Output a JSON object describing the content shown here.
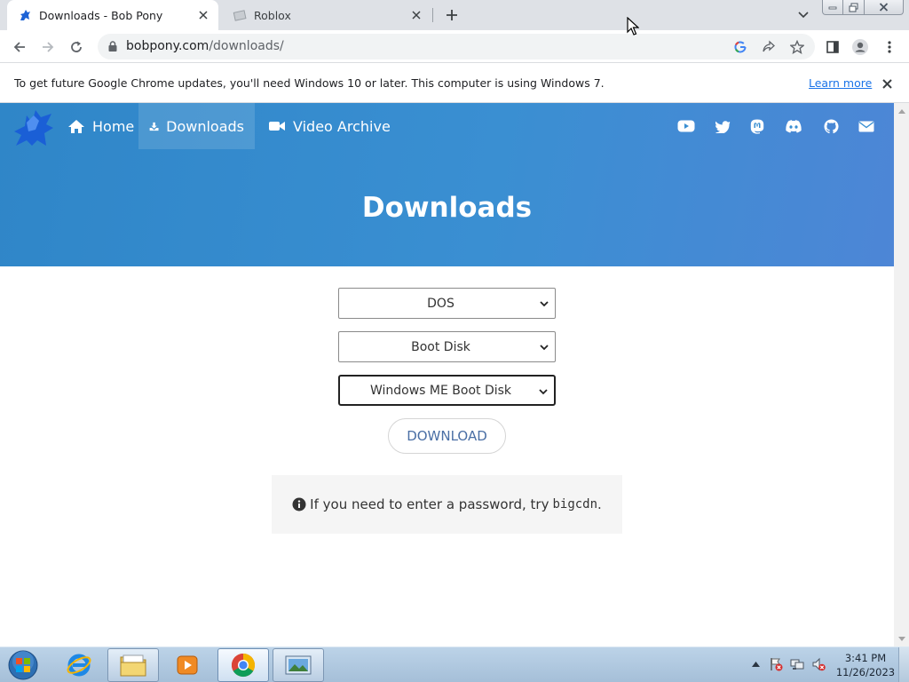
{
  "browser": {
    "tabs": [
      {
        "title": "Downloads - Bob Pony",
        "active": true
      },
      {
        "title": "Roblox",
        "active": false
      }
    ],
    "address": {
      "domain": "bobpony.com",
      "path": "/downloads/"
    }
  },
  "infobar": {
    "message": "To get future Google Chrome updates, you'll need Windows 10 or later. This computer is using Windows 7.",
    "learn_more": "Learn more"
  },
  "site": {
    "nav": [
      {
        "label": "Home",
        "icon": "home-icon"
      },
      {
        "label": "Downloads",
        "icon": "download-icon",
        "active": true
      },
      {
        "label": "Video Archive",
        "icon": "video-camera-icon"
      }
    ],
    "social": [
      "youtube-icon",
      "twitter-icon",
      "mastodon-icon",
      "discord-icon",
      "github-icon",
      "email-icon"
    ],
    "heading": "Downloads",
    "selects": [
      {
        "value": "DOS"
      },
      {
        "value": "Boot Disk"
      },
      {
        "value": "Windows ME Boot Disk"
      }
    ],
    "download_button": "DOWNLOAD",
    "notice_text": "If you need to enter a password, try",
    "notice_code": "bigcdn",
    "notice_end": ".",
    "colors": {
      "hero_start": "#2f86c8",
      "hero_end": "#4d86d6",
      "button_text": "#4a6fa5"
    }
  },
  "taskbar": {
    "apps": [
      "internet-explorer-icon",
      "file-explorer-icon",
      "media-player-icon",
      "chrome-icon",
      "photo-viewer-icon"
    ],
    "time": "3:41 PM",
    "date": "11/26/2023"
  }
}
